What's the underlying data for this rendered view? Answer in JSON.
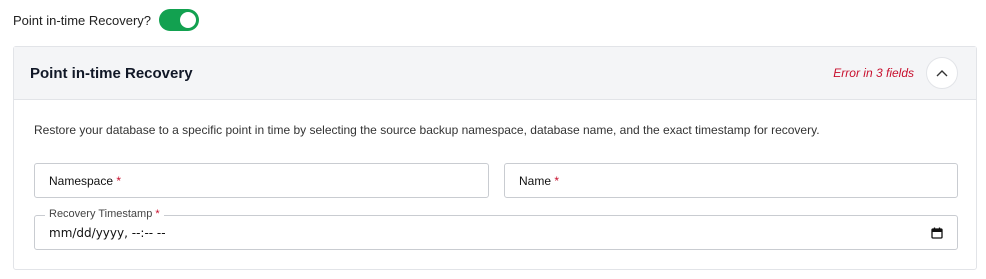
{
  "toggle": {
    "label": "Point in-time Recovery?",
    "checked": true,
    "color": "#12a150"
  },
  "panel": {
    "title": "Point in-time Recovery",
    "error": "Error in 3 fields",
    "collapse_icon": "chevron-up-icon",
    "description": "Restore your database to a specific point in time by selecting the source backup namespace, database name, and the exact timestamp for recovery.",
    "fields": {
      "namespace": {
        "label": "Namespace",
        "required_mark": "*"
      },
      "name": {
        "label": "Name",
        "required_mark": "*"
      },
      "timestamp": {
        "label": "Recovery Timestamp",
        "required_mark": "*",
        "value": "mm/dd/yyyy, --:-- --",
        "icon": "calendar-icon"
      }
    }
  },
  "colors": {
    "error": "#c8102e",
    "header_bg": "#f4f5f7",
    "border": "#e2e4e8"
  }
}
